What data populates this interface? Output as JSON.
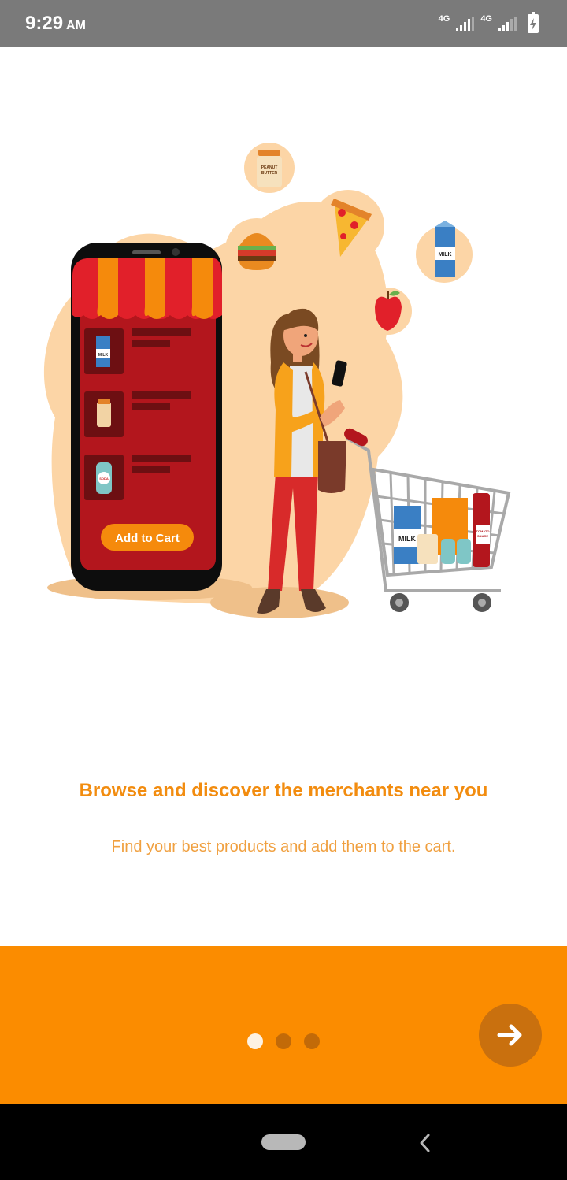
{
  "status_bar": {
    "time": "9:29",
    "ampm": "AM",
    "network_1": "4G",
    "network_2": "4G"
  },
  "illustration": {
    "add_to_cart_label": "Add to Cart",
    "milk_label": "MILK",
    "peanut_butter_label_1": "PEANUT",
    "peanut_butter_label_2": "BUTTER",
    "soda_label": "SODA",
    "tomato_label_1": "TOMATO",
    "tomato_label_2": "SAUCE"
  },
  "onboarding": {
    "title": "Browse and discover the merchants near you",
    "subtitle": "Find your best products and add them to the cart.",
    "page_index": 0,
    "page_count": 3
  },
  "colors": {
    "accent": "#fb8c00",
    "title": "#f28c0f",
    "subtitle": "#f0a040"
  },
  "icons": {
    "next": "arrow-right-icon",
    "back": "chevron-left-icon"
  }
}
